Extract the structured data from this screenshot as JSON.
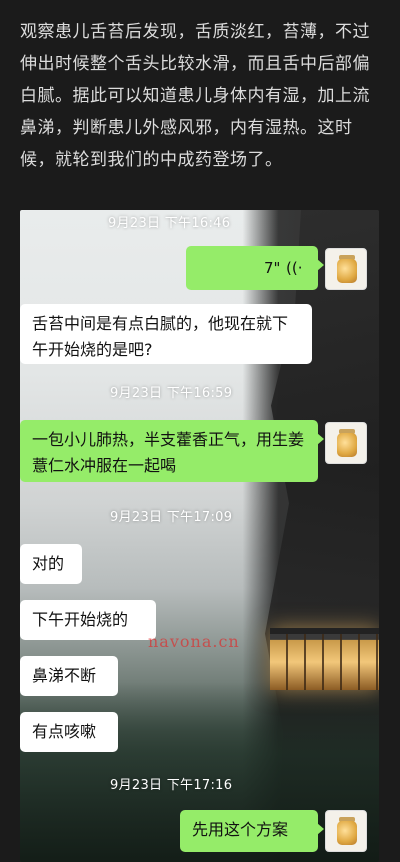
{
  "article": {
    "text": "观察患儿舌苔后发现，舌质淡红，苔薄，不过伸出时候整个舌头比较水滑，而且舌中后部偏白腻。据此可以知道患儿身体内有湿，加上流鼻涕，判断患儿外感风邪，内有湿热。这时候，就轮到我们的中成药登场了。"
  },
  "chat": {
    "timestamps": [
      "9月23日 下午16:46",
      "9月23日 下午16:59",
      "9月23日 下午17:09",
      "9月23日 下午17:16"
    ],
    "voice": {
      "duration": "7\"",
      "icon": "voice-wave-icon"
    },
    "messages": {
      "m1": "舌苔中间是有点白腻的，他现在就下午开始烧的是吧?",
      "m2": "一包小儿肺热，半支藿香正气，用生姜薏仁水冲服在一起喝",
      "m3": "对的",
      "m4": "下午开始烧的",
      "m5": "鼻涕不断",
      "m6": "有点咳嗽",
      "m7": "先用这个方案"
    },
    "watermark": "navona.cn"
  },
  "colors": {
    "outgoing": "#95ec69",
    "incoming": "#ffffff",
    "page_bg": "#1b1b1b"
  }
}
